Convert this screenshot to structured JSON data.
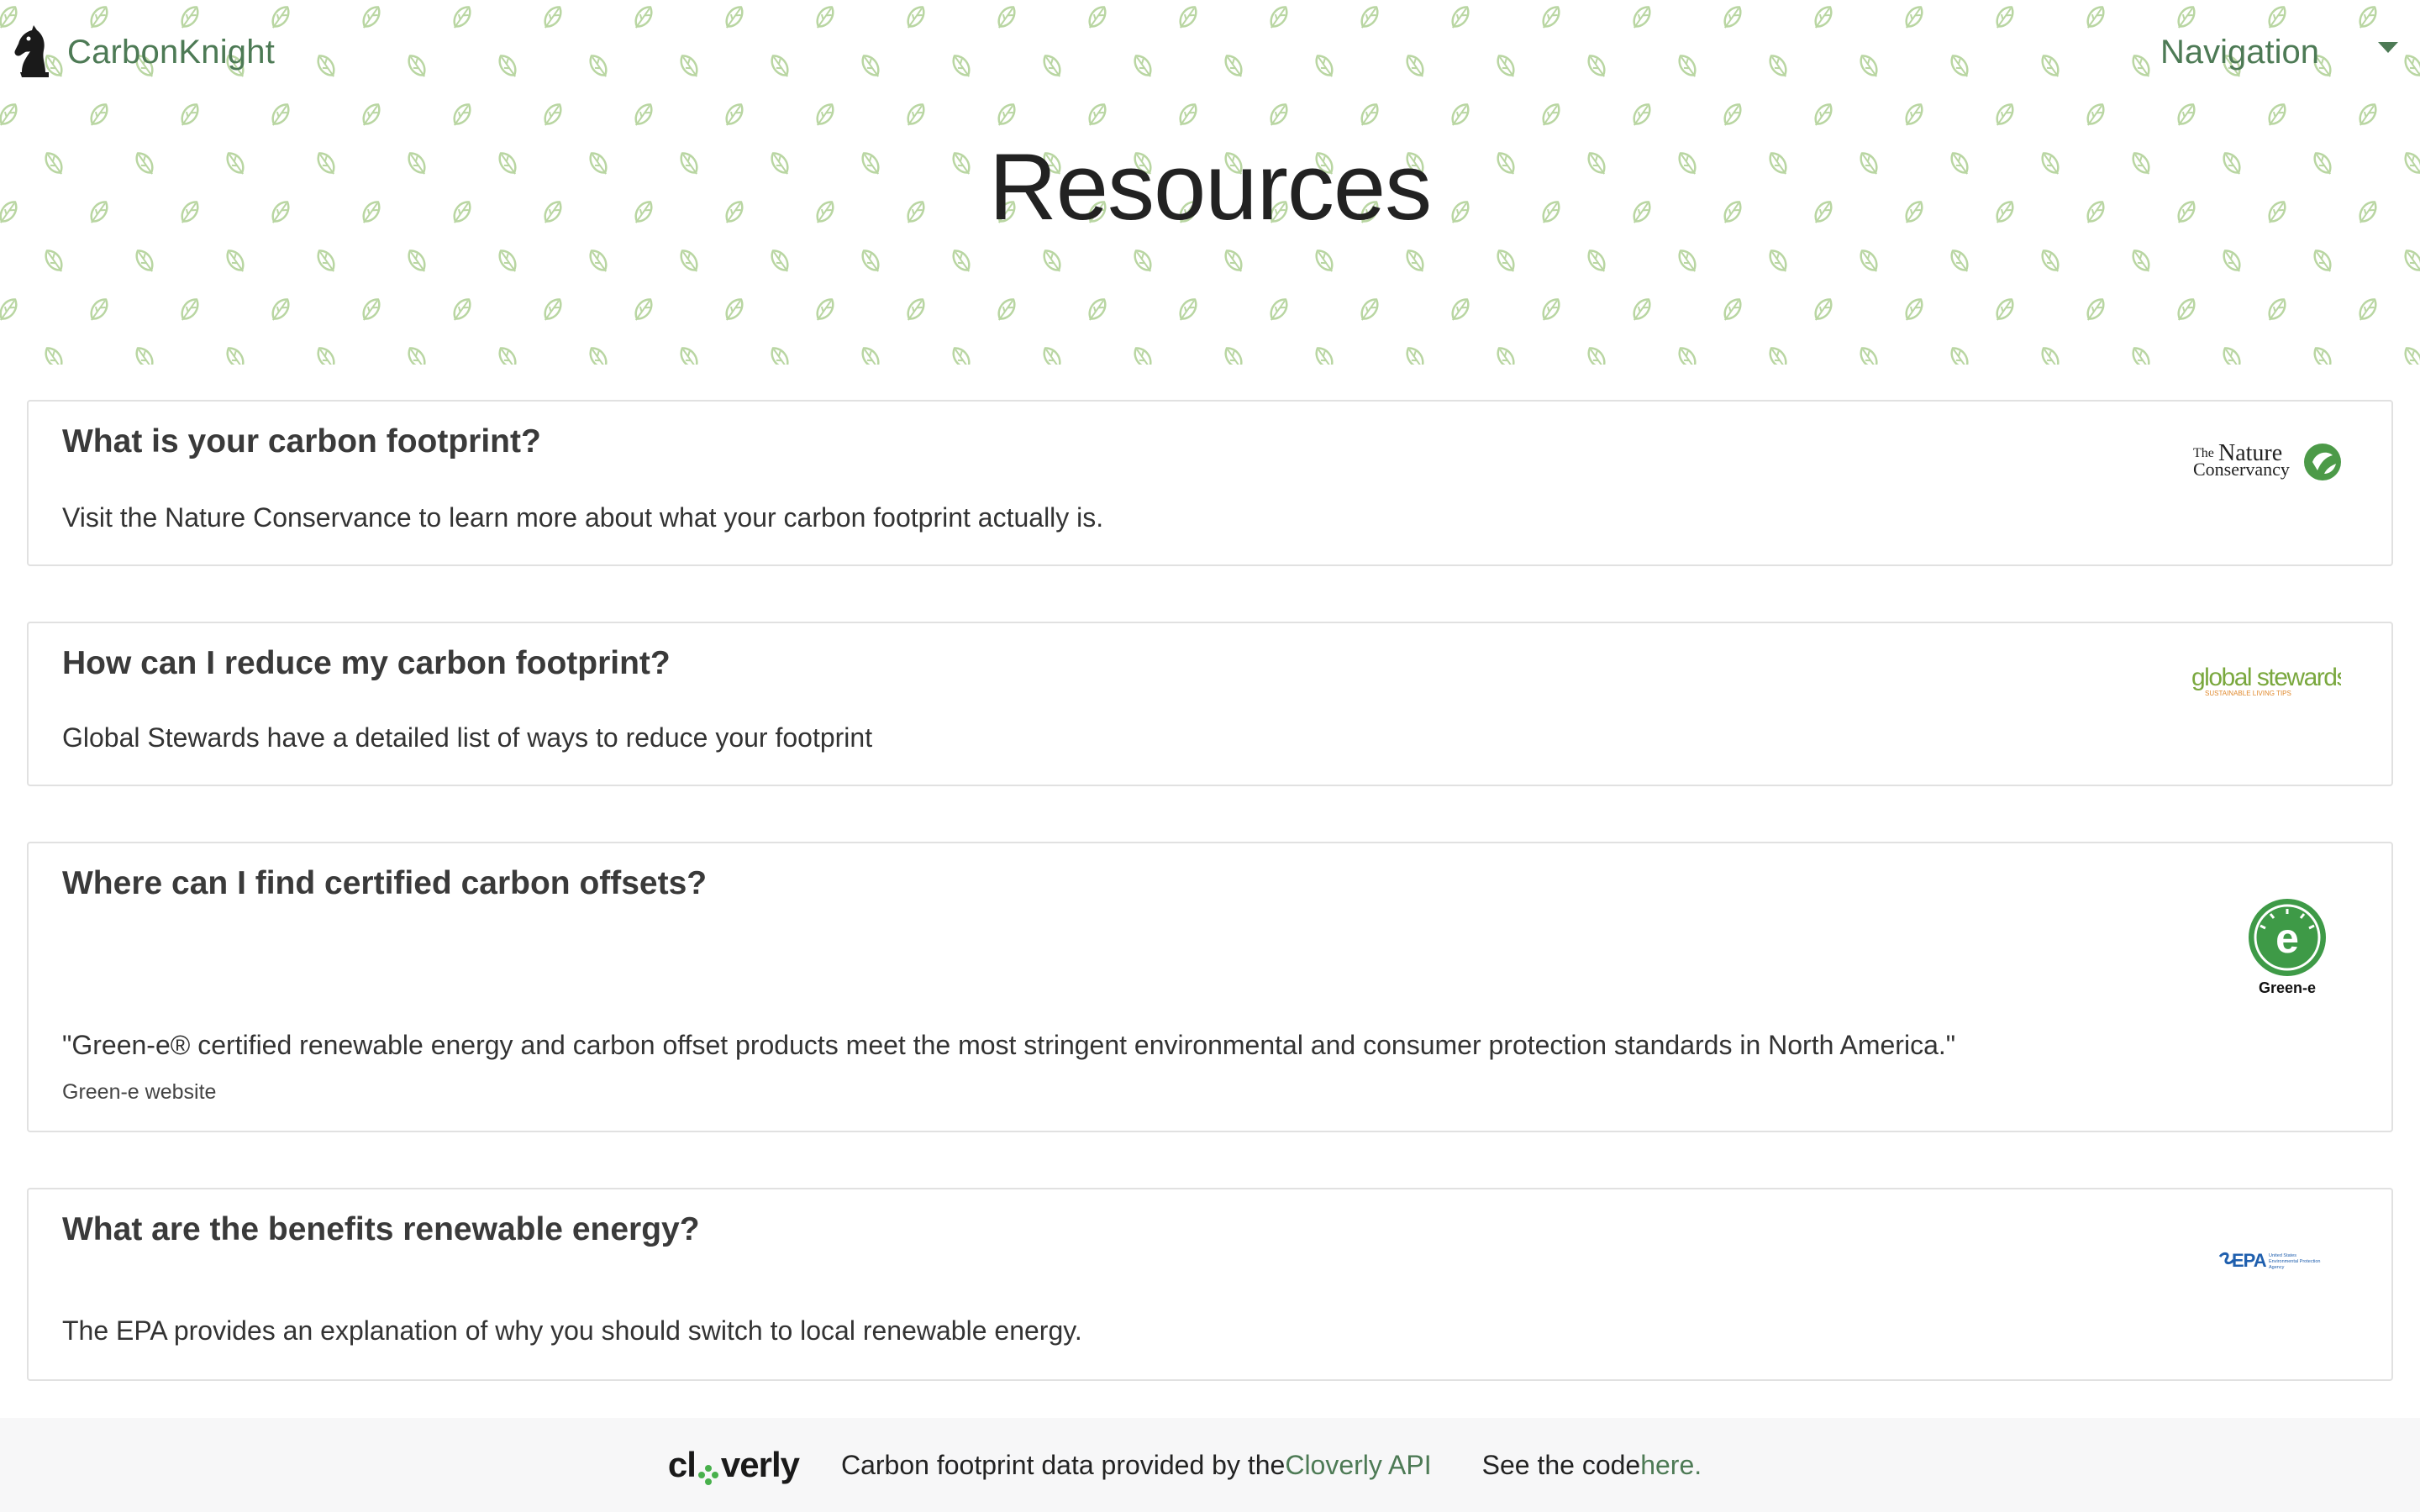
{
  "navbar": {
    "brand": "CarbonKnight",
    "brand_icon": "chess-knight-icon",
    "nav_label": "Navigation",
    "caret_icon": "caret-down-icon"
  },
  "hero": {
    "title": "Resources",
    "background_icon": "leaf-icon"
  },
  "cards": [
    {
      "title": "What is your carbon footprint?",
      "text": "Visit the Nature Conservance to learn more about what your carbon footprint actually is.",
      "logo": {
        "line1": "The",
        "line2": "Nature",
        "line3": "Conservancy"
      }
    },
    {
      "title": "How can I reduce my carbon footprint?",
      "text": "Global Stewards have a detailed list of ways to reduce your footprint",
      "logo": {
        "main": "global stewards",
        "sub": "SUSTAINABLE LIVING TIPS"
      }
    },
    {
      "title": "Where can I find certified carbon offsets?",
      "text": "\"Green-e® certified renewable energy and carbon offset products meet the most stringent environmental and consumer protection standards in North America.\"",
      "caption": "Green-e website",
      "logo": {
        "label": "Green-e",
        "mark": "e"
      }
    },
    {
      "title": "What are the benefits renewable energy?",
      "text": "The EPA provides an explanation of why you should switch to local renewable energy.",
      "logo": {
        "main": "EPA",
        "sub1": "United States",
        "sub2": "Environmental Protection",
        "sub3": "Agency"
      }
    }
  ],
  "footer": {
    "cloverly_before": "cl",
    "cloverly_after": "verly",
    "data_text": "Carbon footprint data provided by the ",
    "data_link": "Cloverly API",
    "code_text": "See the code ",
    "code_link": "here."
  },
  "colors": {
    "brand_green": "#4d7a55",
    "leaf_green": "#b9d6a2",
    "greene_green": "#3e9a47",
    "epa_blue": "#1f5fae"
  }
}
